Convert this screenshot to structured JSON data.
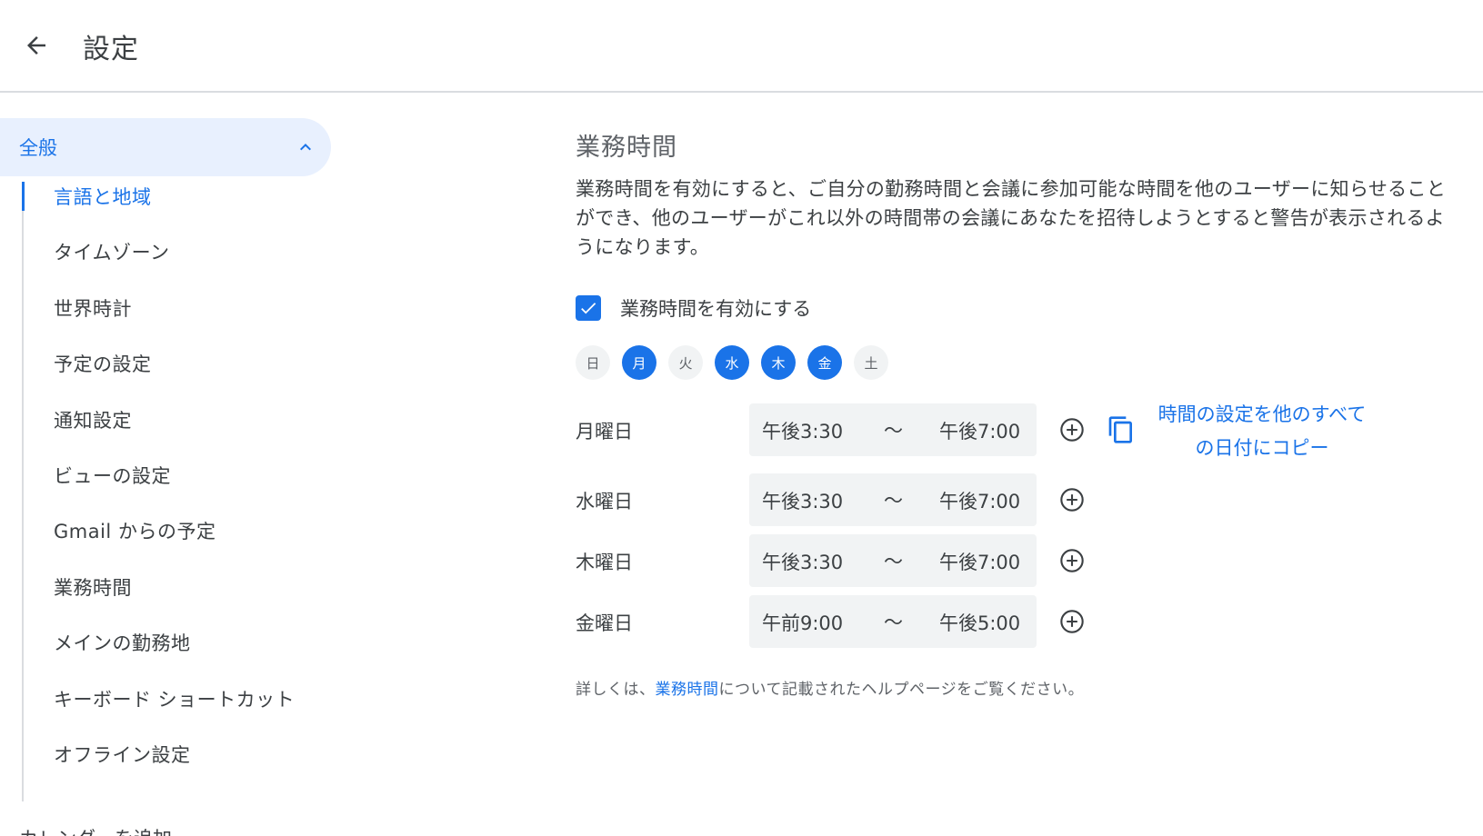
{
  "header": {
    "title": "設定",
    "back_icon": "arrow-back-icon"
  },
  "sidebar": {
    "section_label": "全般",
    "section_chevron_icon": "chevron-up-icon",
    "items": [
      {
        "label": "言語と地域",
        "active": true
      },
      {
        "label": "タイムゾーン"
      },
      {
        "label": "世界時計"
      },
      {
        "label": "予定の設定"
      },
      {
        "label": "通知設定"
      },
      {
        "label": "ビューの設定"
      },
      {
        "label": "Gmail からの予定"
      },
      {
        "label": "業務時間"
      },
      {
        "label": "メインの勤務地"
      },
      {
        "label": "キーボード ショートカット"
      },
      {
        "label": "オフライン設定"
      }
    ],
    "cut_off_item": "カレンダーを追加"
  },
  "main": {
    "title": "業務時間",
    "description": "業務時間を有効にすると、ご自分の勤務時間と会議に参加可能な時間を他のユーザーに知らせることができ、他のユーザーがこれ以外の時間帯の会議にあなたを招待しようとすると警告が表示されるようになります。",
    "enable_checkbox": {
      "label": "業務時間を有効にする",
      "checked": true
    },
    "days": [
      {
        "label": "日",
        "selected": false
      },
      {
        "label": "月",
        "selected": true
      },
      {
        "label": "火",
        "selected": false
      },
      {
        "label": "水",
        "selected": true
      },
      {
        "label": "木",
        "selected": true
      },
      {
        "label": "金",
        "selected": true
      },
      {
        "label": "土",
        "selected": false
      }
    ],
    "rows": [
      {
        "day": "月曜日",
        "start": "午後3:30",
        "separator": "〜",
        "end": "午後7:00"
      },
      {
        "day": "水曜日",
        "start": "午後3:30",
        "separator": "〜",
        "end": "午後7:00"
      },
      {
        "day": "木曜日",
        "start": "午後3:30",
        "separator": "〜",
        "end": "午後7:00"
      },
      {
        "day": "金曜日",
        "start": "午前9:00",
        "separator": "〜",
        "end": "午後5:00"
      }
    ],
    "copy_link_line1": "時間の設定を他のすべて",
    "copy_link_line2": "の日付にコピー",
    "help_prefix": "詳しくは、",
    "help_link": "業務時間",
    "help_suffix": "について記載されたヘルプページをご覧ください。"
  },
  "colors": {
    "accent": "#1a73e8",
    "chip_bg": "#f1f3f4",
    "nav_active_bg": "#e8f0fe"
  }
}
